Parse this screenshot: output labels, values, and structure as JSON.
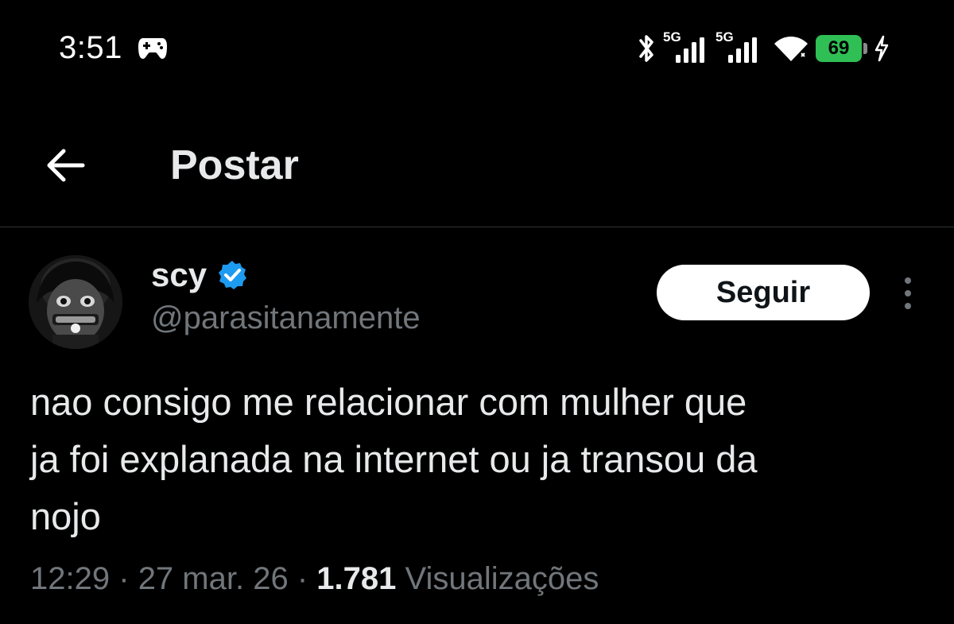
{
  "status_bar": {
    "time": "3:51",
    "app_icon": "game-controller-icon",
    "sim1_label": "5G",
    "sim2_label": "5G",
    "battery_level": "69",
    "icons": [
      "bluetooth-icon",
      "signal-icon",
      "signal-icon",
      "wifi-icon",
      "battery-icon",
      "charging-icon"
    ],
    "battery_color": "#2fbf55"
  },
  "header": {
    "back_icon": "arrow-left-icon",
    "title": "Postar"
  },
  "post": {
    "author": {
      "name": "scy",
      "handle": "@parasitanamente",
      "verified": true,
      "verified_color": "#1d9bf0"
    },
    "follow_label": "Seguir",
    "more_icon": "more-vertical-icon",
    "text_lines": [
      "nao consigo me relacionar com mulher que",
      "ja foi explanada na internet ou ja transou da",
      "nojo"
    ],
    "time": "12:29",
    "separator": "·",
    "date": "27 mar. 26",
    "views_count": "1.781",
    "views_label": "Visualizações"
  },
  "colors": {
    "background": "#000000",
    "primary_text": "#e7e9ea",
    "secondary_text": "#71767b",
    "divider": "#2f3336"
  }
}
